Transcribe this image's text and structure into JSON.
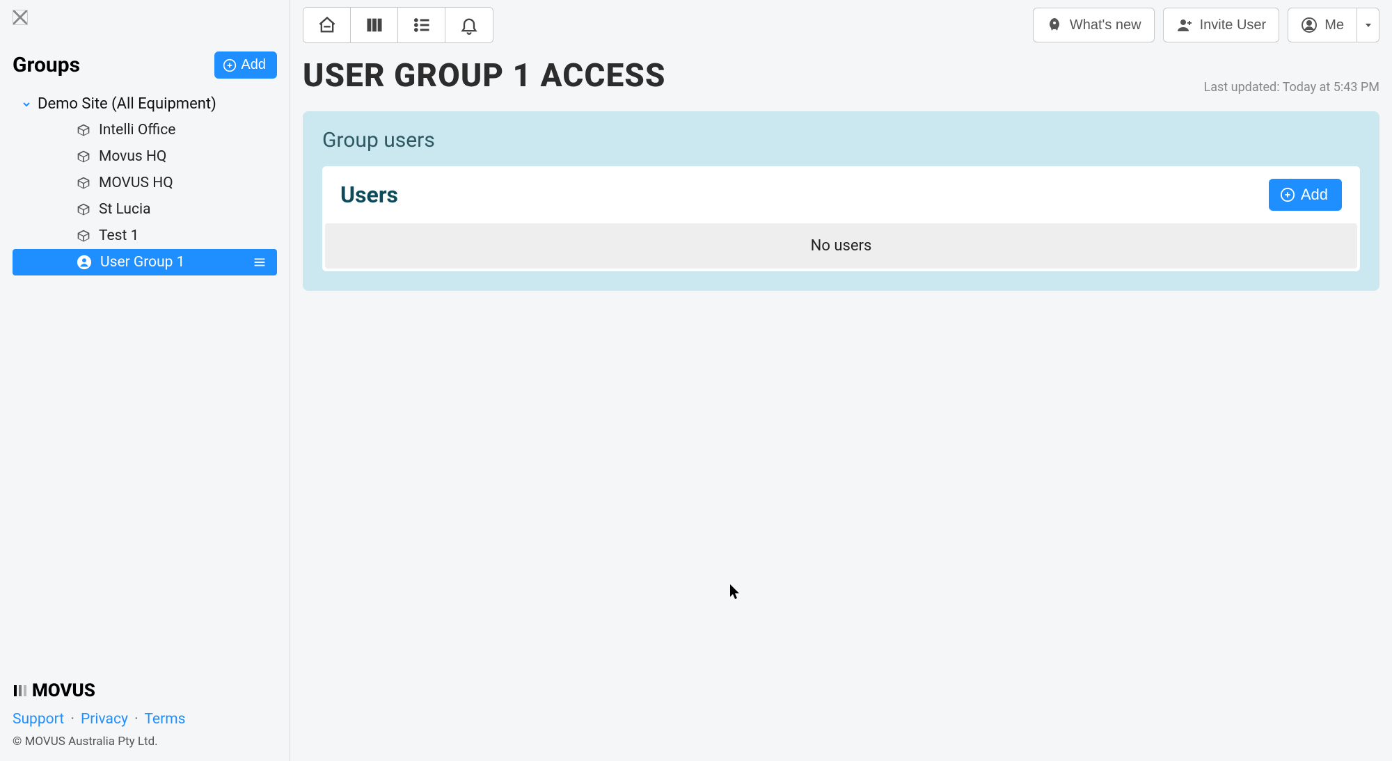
{
  "sidebar": {
    "title": "Groups",
    "add_label": "Add",
    "root": {
      "label": "Demo Site (All Equipment)"
    },
    "items": [
      {
        "label": "Intelli Office",
        "type": "cube"
      },
      {
        "label": "Movus HQ",
        "type": "cube"
      },
      {
        "label": "MOVUS HQ",
        "type": "cube"
      },
      {
        "label": "St Lucia",
        "type": "cube"
      },
      {
        "label": "Test 1",
        "type": "cube"
      },
      {
        "label": "User Group 1",
        "type": "user",
        "selected": true
      }
    ],
    "brand": "MOVUS",
    "footer_links": {
      "support": "Support",
      "privacy": "Privacy",
      "terms": "Terms"
    },
    "copyright": "© MOVUS Australia Pty Ltd."
  },
  "topbar": {
    "whats_new": "What's new",
    "invite_user": "Invite User",
    "me": "Me"
  },
  "page": {
    "title": "USER GROUP 1 ACCESS",
    "last_updated": "Last updated: Today at 5:43 PM"
  },
  "panel": {
    "title": "Group users",
    "users_title": "Users",
    "add_label": "Add",
    "empty_text": "No users"
  }
}
